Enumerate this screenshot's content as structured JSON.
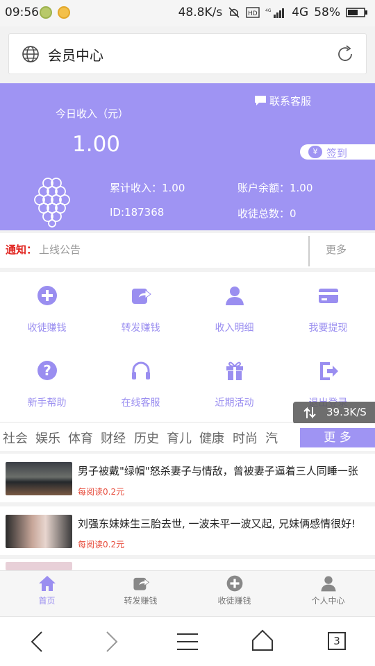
{
  "status_bar": {
    "time": "09:56",
    "speed": "48.8K/s",
    "network": "4G",
    "battery": "58%"
  },
  "address_bar": {
    "title": "会员中心"
  },
  "hero": {
    "customer_service": "联系客服",
    "today_label": "今日收入（元）",
    "today_value": "1.00",
    "checkin": "签到",
    "total_income": "累计收入：1.00",
    "balance": "账户余额：1.00",
    "user_id": "ID:187368",
    "disciples": "收徒总数：0"
  },
  "notice": {
    "label": "通知：",
    "text": "上线公告",
    "more": "更多"
  },
  "grid": [
    {
      "label": "收徒赚钱",
      "icon": "plus-circle-icon"
    },
    {
      "label": "转发赚钱",
      "icon": "share-icon"
    },
    {
      "label": "收入明细",
      "icon": "user-icon"
    },
    {
      "label": "我要提现",
      "icon": "card-icon"
    },
    {
      "label": "新手帮助",
      "icon": "question-icon"
    },
    {
      "label": "在线客服",
      "icon": "headphones-icon"
    },
    {
      "label": "近期活动",
      "icon": "gift-icon"
    },
    {
      "label": "退出登录",
      "icon": "logout-icon"
    }
  ],
  "speed_toast": "39.3K/S",
  "tabs": [
    "社会",
    "娱乐",
    "体育",
    "财经",
    "历史",
    "育儿",
    "健康",
    "时尚",
    "汽"
  ],
  "tabs_more": "更 多",
  "news": [
    {
      "title": "男子被戴\"绿帽\"怒杀妻子与情敌，曾被妻子逼着三人同睡一张",
      "read": "每阅读0.2元"
    },
    {
      "title": "刘强东妹妹生三胎去世, 一波未平一波又起, 兄妹俩感情很好!",
      "read": "每阅读0.2元"
    }
  ],
  "bottom_nav": [
    {
      "label": "首页",
      "icon": "home-icon"
    },
    {
      "label": "转发赚钱",
      "icon": "share-icon"
    },
    {
      "label": "收徒赚钱",
      "icon": "plus-circle-icon"
    },
    {
      "label": "个人中心",
      "icon": "user-icon"
    }
  ],
  "browser": {
    "tab_count": "3"
  },
  "colors": {
    "accent": "#9f94f3",
    "accent_text": "#9a8ef0",
    "notice_red": "#e0201b"
  }
}
